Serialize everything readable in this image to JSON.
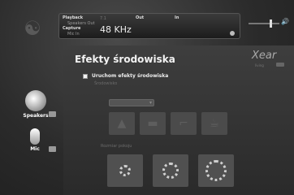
{
  "status": {
    "playback_label": "Playback",
    "playback_sub": "Speakers Out",
    "playback_val": "7.1",
    "capture_label": "Capture",
    "capture_sub": "Mic In",
    "rate": "48 KHz",
    "out_label": "Out",
    "in_label": "In"
  },
  "devices": [
    {
      "label": "Speakers",
      "icon": "speaker-icon"
    },
    {
      "label": "Mic",
      "icon": "mic-icon"
    }
  ],
  "main": {
    "title": "Efekty środowiska",
    "brand": "Xear",
    "brand_sub": "living",
    "enable_label": "Uruchom efekty środowiska",
    "environment_label": "Środowisko",
    "room_size_label": "Rozmiar pokoju",
    "presets": [
      "forest-icon",
      "bathroom-icon",
      "pipe-icon",
      "mug-icon"
    ],
    "room_sizes": [
      "small",
      "medium",
      "large"
    ]
  }
}
